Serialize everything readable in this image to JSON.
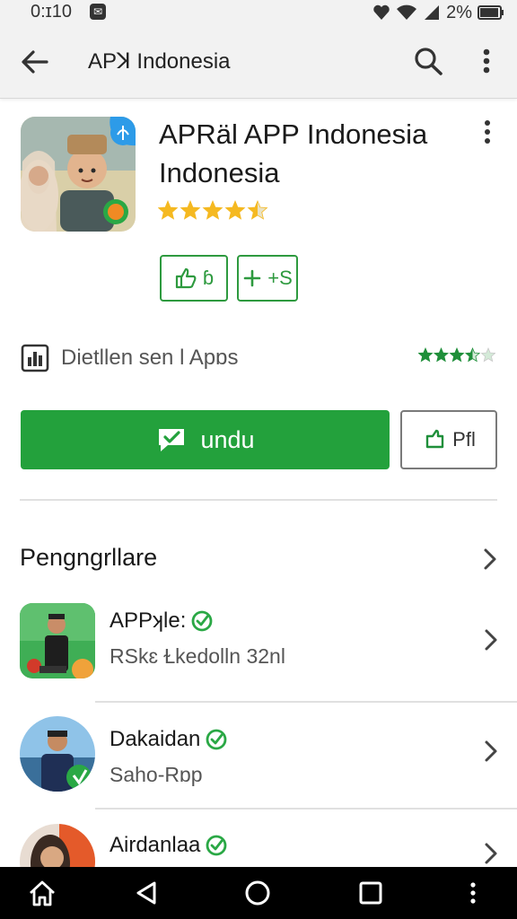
{
  "status_bar": {
    "time": "0:ɪ10",
    "battery": "2%",
    "icons": [
      "notification-icon",
      "heart-icon",
      "wifi-icon",
      "signal-icon",
      "battery-icon"
    ]
  },
  "app_bar": {
    "title": "APꓘ Indonesia",
    "icons": [
      "back-arrow-icon",
      "search-icon",
      "more-vertical-icon"
    ]
  },
  "app": {
    "title": "APRäl APP Indonesia Indonesia",
    "rating_stars": 4.5,
    "chips": [
      {
        "label": "ɓ",
        "icon": "thumbs-up-icon"
      },
      {
        "label": "+S",
        "icon": "plus-icon"
      }
    ]
  },
  "developer": {
    "text": "Dietllen sen l Apɒs",
    "icon": "document-icon",
    "stars": 3.5
  },
  "buttons": {
    "install_label": "undu",
    "install_icon": "chat-check-icon",
    "secondary_label": "Pfl",
    "secondary_icon": "share-icon"
  },
  "section": {
    "title": "Pengngrllare"
  },
  "list": [
    {
      "title": "APPʞle:",
      "subtitle": "RSkɛ Ɫkedolln 32nl",
      "verified": true
    },
    {
      "title": "Dakaidan",
      "subtitle": "Saho-Rɒp",
      "verified": true
    },
    {
      "title": "Airdanlaa",
      "subtitle": "",
      "verified": true
    }
  ],
  "nav_bar": {
    "icons": [
      "home-icon",
      "back-triangle-icon",
      "home-circle-icon",
      "recents-square-icon",
      "more-dots-icon"
    ]
  },
  "colors": {
    "accent_green": "#23a13c",
    "star_gold": "#f5b921",
    "star_green": "#1f8f3a"
  }
}
